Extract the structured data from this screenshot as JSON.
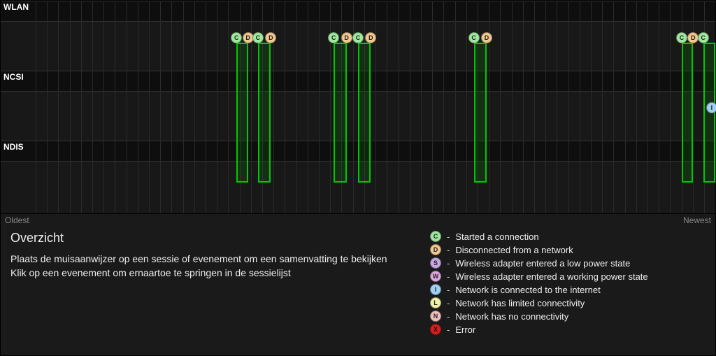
{
  "rows": {
    "wlan": "WLAN",
    "ncsi": "NCSI",
    "ndis": "NDIS"
  },
  "axis": {
    "oldest": "Oldest",
    "newest": "Newest"
  },
  "overview": {
    "title": "Overzicht",
    "line1": "Plaats de muisaanwijzer op een sessie of evenement om een samenvatting te bekijken",
    "line2": "Klik op een evenement om ernaartoe te springen in de sessielijst"
  },
  "legend": {
    "c": {
      "letter": "C",
      "text": "Started a connection"
    },
    "d": {
      "letter": "D",
      "text": "Disconnected from a network"
    },
    "s": {
      "letter": "S",
      "text": "Wireless adapter entered a low power state"
    },
    "w": {
      "letter": "W",
      "text": "Wireless adapter entered a working power state"
    },
    "i": {
      "letter": "I",
      "text": "Network is connected to the internet"
    },
    "l": {
      "letter": "L",
      "text": "Network has limited connectivity"
    },
    "n": {
      "letter": "N",
      "text": "Network has no connectivity"
    },
    "x": {
      "letter": "X",
      "text": "Error"
    }
  },
  "chart_data": {
    "type": "timeline",
    "lanes": [
      "WLAN",
      "NCSI",
      "NDIS"
    ],
    "x_range_percent": [
      0,
      100
    ],
    "sessions": [
      {
        "start_pct": 33.0,
        "end_pct": 34.6
      },
      {
        "start_pct": 36.0,
        "end_pct": 37.8
      },
      {
        "start_pct": 46.6,
        "end_pct": 48.4
      },
      {
        "start_pct": 50.0,
        "end_pct": 51.8
      },
      {
        "start_pct": 66.2,
        "end_pct": 68.0
      },
      {
        "start_pct": 95.3,
        "end_pct": 96.9
      },
      {
        "start_pct": 98.3,
        "end_pct": 100.0
      }
    ],
    "events": [
      {
        "x_pct": 33.0,
        "lane": "WLAN",
        "code": "C"
      },
      {
        "x_pct": 34.6,
        "lane": "WLAN",
        "code": "D"
      },
      {
        "x_pct": 36.0,
        "lane": "WLAN",
        "code": "C"
      },
      {
        "x_pct": 37.8,
        "lane": "WLAN",
        "code": "D"
      },
      {
        "x_pct": 46.6,
        "lane": "WLAN",
        "code": "C"
      },
      {
        "x_pct": 48.4,
        "lane": "WLAN",
        "code": "D"
      },
      {
        "x_pct": 50.0,
        "lane": "WLAN",
        "code": "C"
      },
      {
        "x_pct": 51.8,
        "lane": "WLAN",
        "code": "D"
      },
      {
        "x_pct": 66.2,
        "lane": "WLAN",
        "code": "C"
      },
      {
        "x_pct": 68.0,
        "lane": "WLAN",
        "code": "D"
      },
      {
        "x_pct": 95.3,
        "lane": "WLAN",
        "code": "C"
      },
      {
        "x_pct": 96.9,
        "lane": "WLAN",
        "code": "D"
      },
      {
        "x_pct": 98.3,
        "lane": "WLAN",
        "code": "C"
      },
      {
        "x_pct": 99.5,
        "lane": "NCSI",
        "code": "I"
      }
    ]
  }
}
